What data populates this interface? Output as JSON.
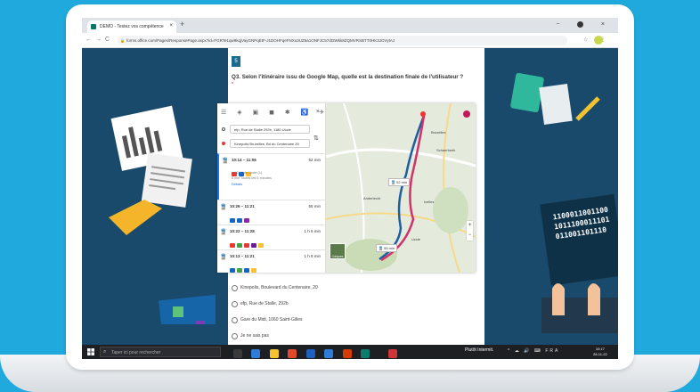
{
  "browser": {
    "tab_title": "DEMO - Testez vos compétence",
    "tab_close": "×",
    "new_tab": "+",
    "window_controls": "−  ▢  ×",
    "nav_icons": "←→C",
    "url": "forms.office.com/Pages/ResponsePage.aspx?id=FGRTe1qw9kqjVayGNPqEtF-J1DOHFqeFNXu3UZ6a1ONFJC57dt3Wkk8ZQMVRSBTT0HK3JOVytAJ",
    "addr_icons": "☆ ⋮"
  },
  "question": {
    "number": "5",
    "text": "Q3. Selon l'itinéraire issu de Google Map, quelle est la destination finale de l'utilisateur ?",
    "required_mark": "*"
  },
  "map": {
    "modes": "☰ ◈ ▣ ◼ ✱ ♿ ✈",
    "close": "×",
    "origin": "efp, Rue de Stalle 292b, 1180 Uccle",
    "destination": "Kinepolis Bruxelles, Bd du Centenaire 20",
    "swap": "⇅",
    "routes": [
      {
        "time": "10:14 – 11:06",
        "duration": "52 min",
        "sub1": "à 10:17 de Uccle (1)",
        "sub2": "8 min       Toutes les 6 minutes",
        "link": "Détails",
        "chips": [
          "#e53935",
          "#1565c0",
          "#fbc02d"
        ]
      },
      {
        "time": "10:26 – 11:21",
        "duration": "55 min",
        "chips": [
          "#1565c0",
          "#1565c0",
          "#8e24aa"
        ]
      },
      {
        "time": "10:22 – 11:28",
        "duration": "1 h 6 min",
        "chips": [
          "#e53935",
          "#43a047",
          "#e53935",
          "#6a1b9a",
          "#fbc02d"
        ]
      },
      {
        "time": "10:13 – 11:21",
        "duration": "1 h 8 min",
        "chips": [
          "#1565c0",
          "#43a047",
          "#1565c0",
          "#fbc02d"
        ]
      }
    ],
    "info1": "🚆 52 min",
    "info2": "🚆 55 min",
    "labels": {
      "schaerbeek": "Schaerbeek",
      "anderlecht": "Anderlecht",
      "ixelles": "Ixelles",
      "uccle": "Uccle",
      "bruxelles": "Bruxelles"
    },
    "zoom": "+ −",
    "layers": "Calques"
  },
  "options": [
    "Kinepolis, Boulevard du Centenaire, 20",
    "efp, Rue de Stalle, 292b",
    "Gare du Midi, 1060 Saint-Gilles",
    "Je ne sais pas"
  ],
  "taskbar": {
    "search_placeholder": "Taper ici pour rechercher",
    "weather": "Plutôt Intermit.",
    "tray": "^ ☁ 🔊 ⌨ FRA",
    "time": "10:17",
    "date": "28-11-22"
  },
  "decor": {
    "binary": [
      "1100011001100",
      "1011100011101",
      "011001101110"
    ]
  }
}
